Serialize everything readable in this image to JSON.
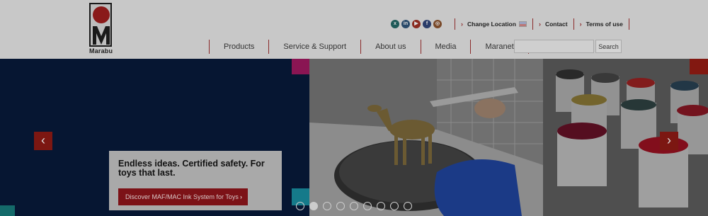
{
  "brand": {
    "logo_text": "Marabu"
  },
  "social": [
    {
      "icon": "xing-icon",
      "color": "#1f5a58",
      "glyph": "x"
    },
    {
      "icon": "linkedin-icon",
      "color": "#2a4a6a",
      "glyph": "in"
    },
    {
      "icon": "youtube-icon",
      "color": "#8a2a20",
      "glyph": "▶"
    },
    {
      "icon": "facebook-icon",
      "color": "#2b3d6a",
      "glyph": "f"
    },
    {
      "icon": "instagram-icon",
      "color": "#7a4a2a",
      "glyph": "◎"
    }
  ],
  "topnav": {
    "change_location": "Change Location",
    "contact": "Contact",
    "terms": "Terms of use"
  },
  "mainnav": [
    "Products",
    "Service & Support",
    "About us",
    "Media",
    "Maranet"
  ],
  "search": {
    "placeholder": "",
    "button": "Search"
  },
  "slider": {
    "headline": "Endless ideas. Certified safety. For toys that last.",
    "cta": "Discover MAF/MAC Ink System for Toys",
    "prev": "‹",
    "next": "›",
    "dots": 9,
    "active_dot": 1
  },
  "colors": {
    "accent": "#7c1217",
    "navy": "#061632",
    "magenta": "#8a1553",
    "cyan": "#157a8a",
    "yellow": "#8a6a15"
  }
}
